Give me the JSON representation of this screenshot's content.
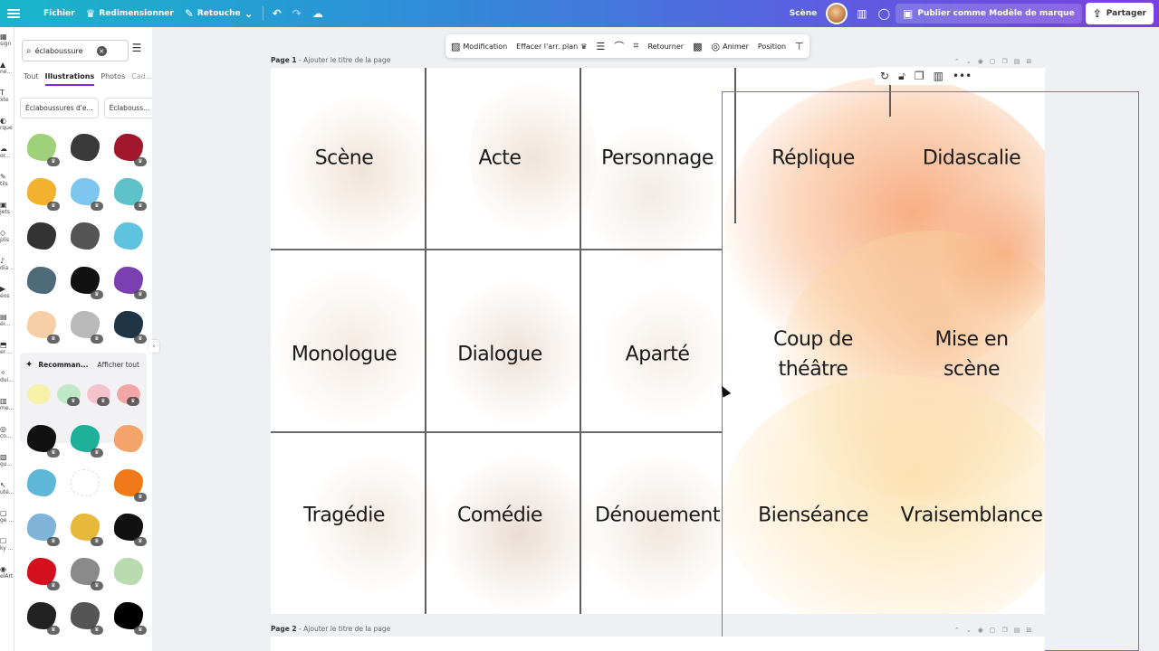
{
  "topbar": {
    "file": "Fichier",
    "resize": "Redimensionner",
    "retouch": "Retouche",
    "scene_title": "Scène",
    "publish": "Publier comme Modèle de marque",
    "share": "Partager"
  },
  "rail": [
    {
      "icon": "▦",
      "label": "sign"
    },
    {
      "icon": "▲",
      "label": "ne..."
    },
    {
      "icon": "T",
      "label": "xte"
    },
    {
      "icon": "◐",
      "label": "rque"
    },
    {
      "icon": "☁",
      "label": "or..."
    },
    {
      "icon": "✎",
      "label": "tils"
    },
    {
      "icon": "▣",
      "label": "jets"
    },
    {
      "icon": "◇",
      "label": "plis"
    },
    {
      "icon": "♪",
      "label": "dia ..."
    },
    {
      "icon": "▶",
      "label": "éos"
    },
    {
      "icon": "▤",
      "label": "ér..."
    },
    {
      "icon": "⬒",
      "label": "er ..."
    },
    {
      "icon": "✧",
      "label": "dui..."
    },
    {
      "icon": "▥",
      "label": "me..."
    },
    {
      "icon": "◎",
      "label": "co..."
    },
    {
      "icon": "▧",
      "label": "gu..."
    },
    {
      "icon": "↖",
      "label": "uté..."
    },
    {
      "icon": "▢",
      "label": "ge ..."
    },
    {
      "icon": "☐",
      "label": "ky ..."
    },
    {
      "icon": "◉",
      "label": "elArt"
    }
  ],
  "panel": {
    "search_value": "éclaboussure",
    "tabs": [
      "Tout",
      "Illustrations",
      "Photos",
      "Cad..."
    ],
    "active_tab": "Illustrations",
    "chips": [
      "Éclaboussures d'e...",
      "Éclabouss..."
    ],
    "recommended": "Recomman...",
    "see_all": "Afficher tout"
  },
  "ctx": {
    "edit": "Modification",
    "remove_bg": "Effacer l'arr. plan",
    "flip": "Retourner",
    "animate": "Animer",
    "position": "Position"
  },
  "pages": {
    "page1_label": "Page 1",
    "page2_label": "Page 2",
    "add_title": "Ajouter le titre de la page"
  },
  "cards": {
    "row1": [
      "Scène",
      "Acte",
      "Personnage",
      "Réplique",
      "Didascalie"
    ],
    "row2": [
      "Monologue",
      "Dialogue",
      "Aparté",
      "Coup de\nthéâtre",
      "Mise en\nscène"
    ],
    "row3": [
      "Tragédie",
      "Comédie",
      "Dénouement",
      "Bienséance",
      "Vraisemblance"
    ]
  },
  "colors": {
    "accent": "#7d2ae8",
    "selection": "#8b5cf6",
    "peach": "#f6b07a",
    "beige": "#e9d6c4"
  }
}
